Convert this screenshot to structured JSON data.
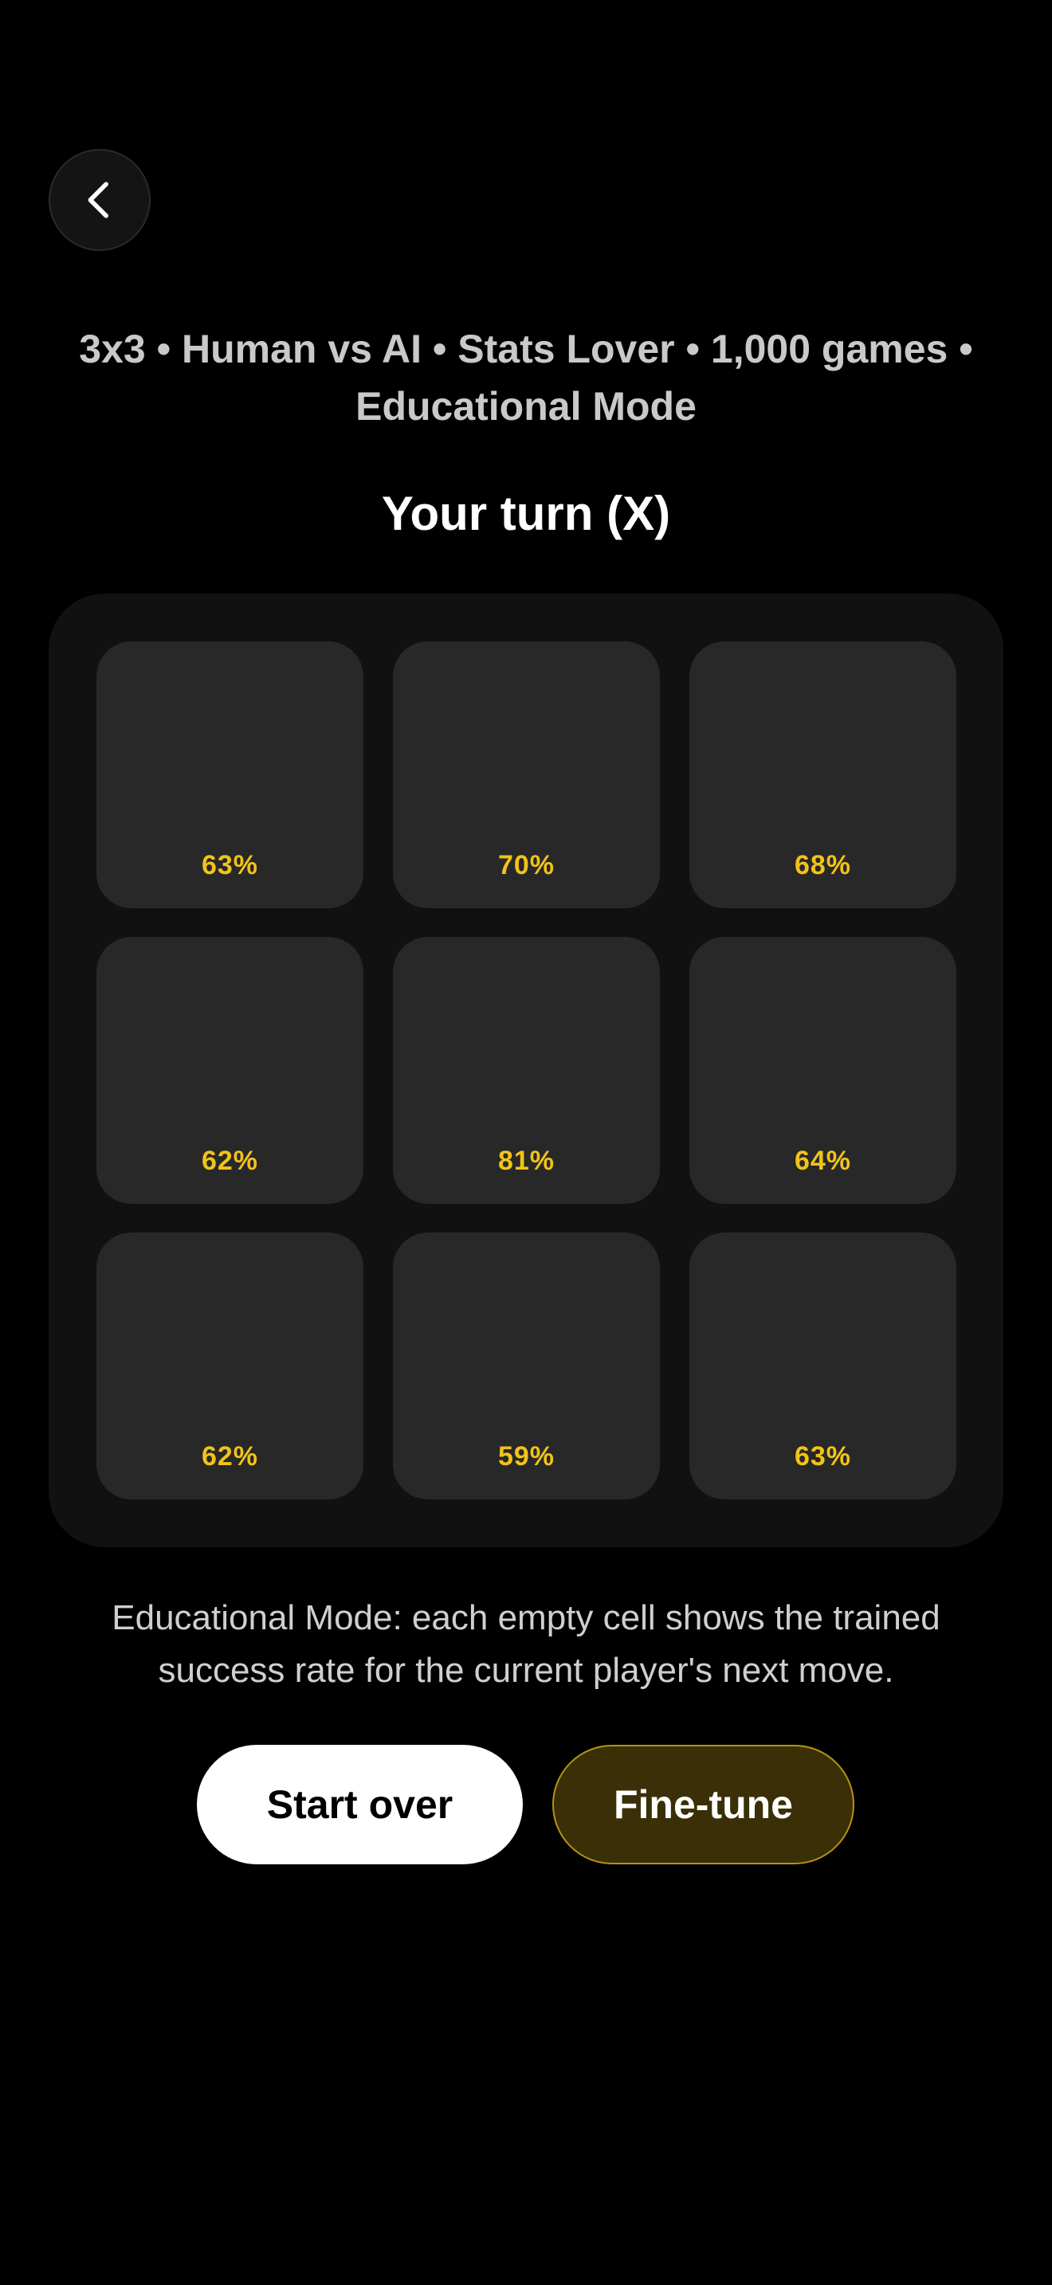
{
  "header": {
    "back_icon": "chevron-left-icon"
  },
  "game": {
    "subtitle_line1": "3x3 • Human vs AI • Stats Lover • 1,000 games •",
    "subtitle_line2": "Educational Mode",
    "turn_text": "Your turn (X)"
  },
  "board": {
    "size": 3,
    "cells": [
      {
        "row": 1,
        "col": 1,
        "rate": "63%"
      },
      {
        "row": 1,
        "col": 2,
        "rate": "70%"
      },
      {
        "row": 1,
        "col": 3,
        "rate": "68%"
      },
      {
        "row": 2,
        "col": 1,
        "rate": "62%"
      },
      {
        "row": 2,
        "col": 2,
        "rate": "81%"
      },
      {
        "row": 2,
        "col": 3,
        "rate": "64%"
      },
      {
        "row": 3,
        "col": 1,
        "rate": "62%"
      },
      {
        "row": 3,
        "col": 2,
        "rate": "59%"
      },
      {
        "row": 3,
        "col": 3,
        "rate": "63%"
      }
    ]
  },
  "info": {
    "line1": "Educational Mode: each empty cell shows the trained",
    "line2": "success rate for the current player's next move."
  },
  "actions": {
    "start_over_label": "Start over",
    "fine_tune_label": "Fine-tune"
  },
  "colors": {
    "background": "#000000",
    "board_bg": "#111111",
    "cell_bg": "#282828",
    "rate_text": "#f2c318",
    "fine_tune_bg": "#3a2f06",
    "fine_tune_border": "#b8930f"
  }
}
